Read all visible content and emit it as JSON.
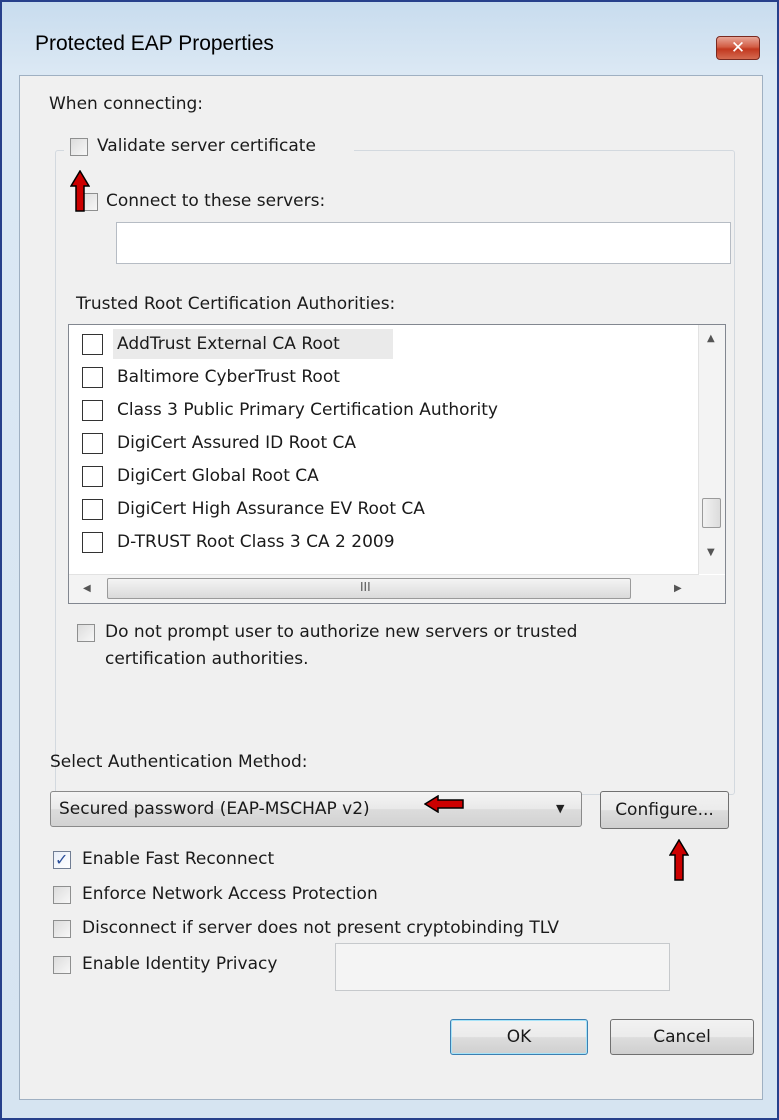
{
  "window": {
    "title": "Protected EAP Properties",
    "close_glyph": "✕"
  },
  "connecting": {
    "heading": "When connecting:",
    "validate_cert": {
      "label": "Validate server certificate",
      "checked": false
    },
    "connect_servers": {
      "label": "Connect to these servers:",
      "checked": false,
      "value": ""
    },
    "trusted_root_label": "Trusted Root Certification Authorities:",
    "ca_list": [
      {
        "label": "AddTrust External CA Root",
        "checked": false,
        "selected": true
      },
      {
        "label": "Baltimore CyberTrust Root",
        "checked": false
      },
      {
        "label": "Class 3 Public Primary Certification Authority",
        "checked": false
      },
      {
        "label": "DigiCert Assured ID Root CA",
        "checked": false
      },
      {
        "label": "DigiCert Global Root CA",
        "checked": false
      },
      {
        "label": "DigiCert High Assurance EV Root CA",
        "checked": false
      },
      {
        "label": "D-TRUST Root Class 3 CA 2 2009",
        "checked": false
      }
    ],
    "hscroll_grip": "III",
    "do_not_prompt": {
      "line1": "Do not prompt user to authorize new servers or trusted",
      "line2": "certification authorities.",
      "checked": false
    }
  },
  "auth": {
    "heading": "Select Authentication Method:",
    "selected_method": "Secured password (EAP-MSCHAP v2)",
    "configure_label": "Configure..."
  },
  "options": [
    {
      "label": "Enable Fast Reconnect",
      "checked": true
    },
    {
      "label": "Enforce Network Access Protection",
      "checked": false
    },
    {
      "label": "Disconnect if server does not present cryptobinding TLV",
      "checked": false
    },
    {
      "label": "Enable Identity Privacy",
      "checked": false
    }
  ],
  "identity_privacy_value": "",
  "buttons": {
    "ok": "OK",
    "cancel": "Cancel"
  },
  "annotation_color": "#cc0000"
}
